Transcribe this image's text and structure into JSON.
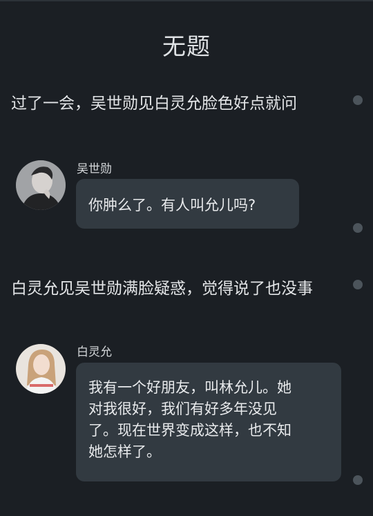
{
  "title": "无题",
  "narrations": [
    "过了一会，吴世勋见白灵允脸色好点就问",
    "白灵允见吴世勋满脸疑惑，觉得说了也没事"
  ],
  "messages": [
    {
      "speaker": "吴世勋",
      "avatar_icon": "male-avatar-icon",
      "lines": [
        "你肿么了。有人叫允儿吗?"
      ]
    },
    {
      "speaker": "白灵允",
      "avatar_icon": "female-avatar-icon",
      "lines": [
        "我有一个好朋友，叫林允儿。她",
        "对我很好，我们有好多年没见",
        "了。现在世界变成这样，也不知",
        "她怎样了。"
      ]
    }
  ],
  "colors": {
    "background": "#1b1f24",
    "bubble": "#323a41",
    "dot": "#4c545b"
  }
}
